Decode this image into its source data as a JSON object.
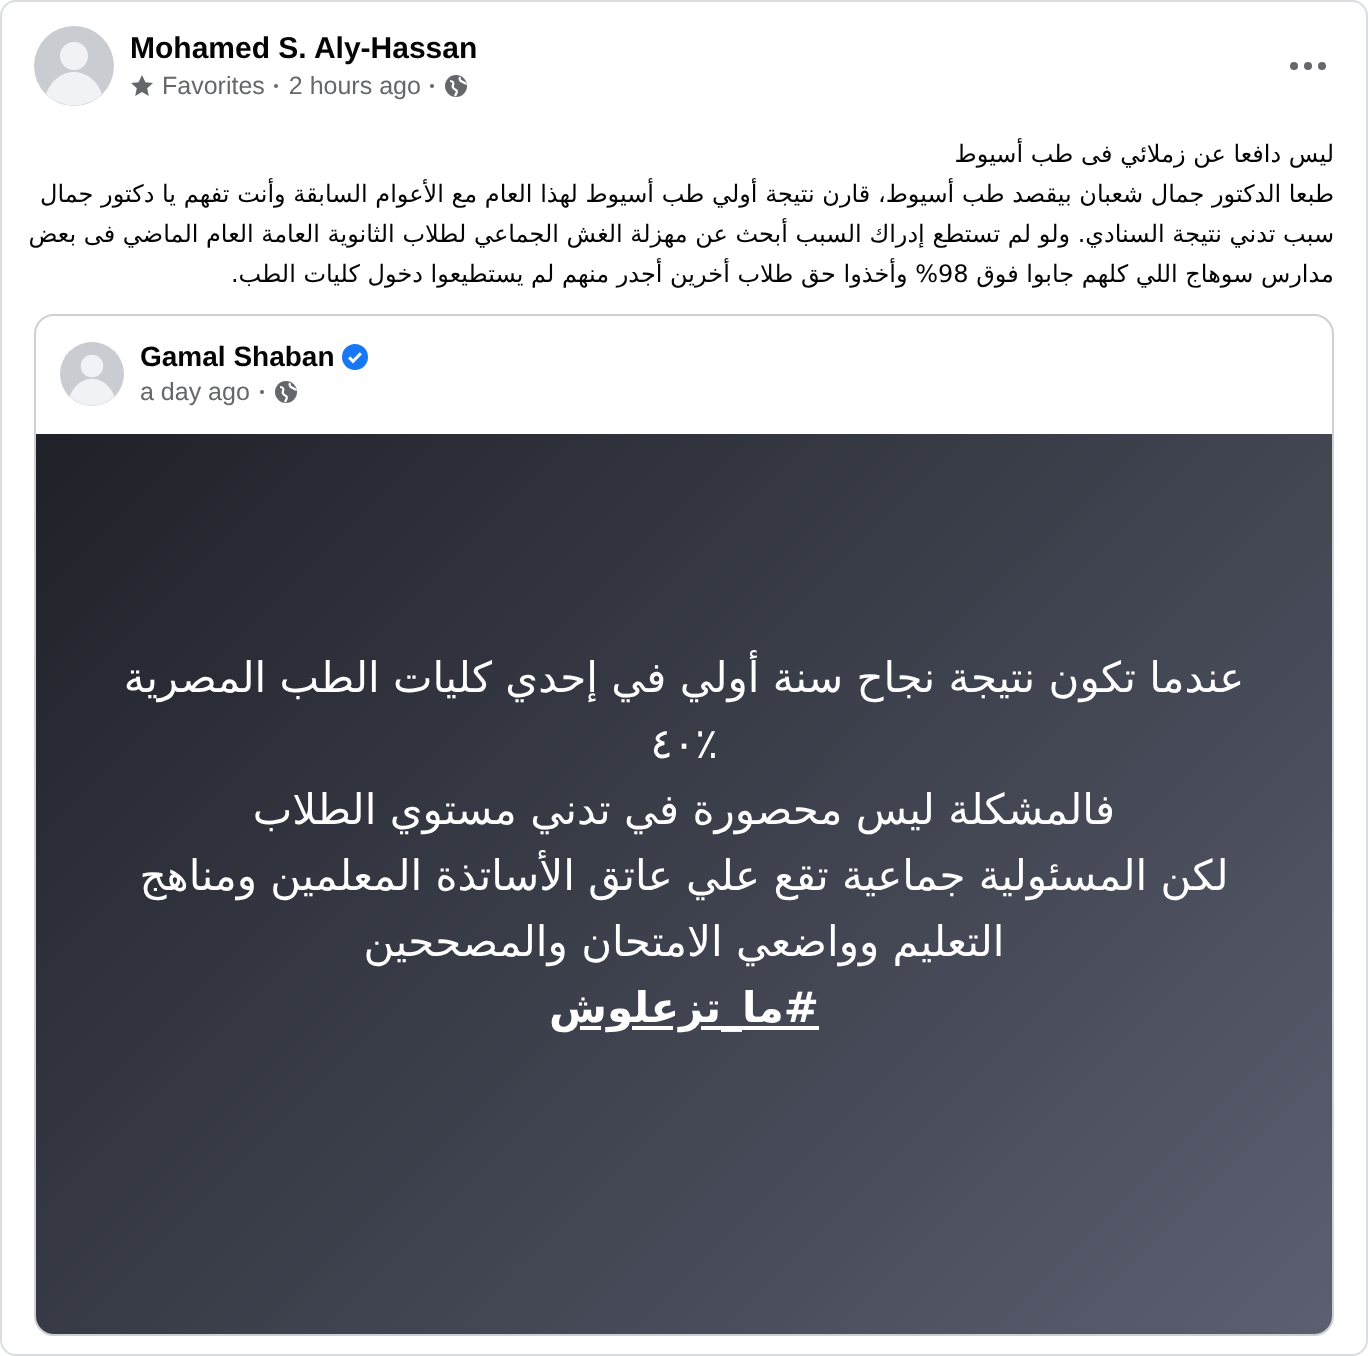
{
  "post": {
    "author": "Mohamed S. Aly-Hassan",
    "audience": "Favorites",
    "time": "2 hours ago",
    "text_lines": [
      "ليس دافعا عن زملائي فى طب أسيوط",
      "طبعا الدكتور جمال شعبان بيقصد طب أسيوط، قارن نتيجة أولي طب أسيوط لهذا العام مع الأعوام السابقة وأنت تفهم يا دكتور جمال",
      "سبب تدني نتيجة السنادي. ولو لم تستطع إدراك السبب أبحث عن مهزلة الغش الجماعي لطلاب الثانوية العامة العام الماضي فى بعض",
      "مدارس سوهاج اللي كلهم جابوا فوق 98% وأخذوا حق طلاب أخرين أجدر منهم لم يستطيعوا دخول كليات الطب."
    ]
  },
  "shared_post": {
    "author": "Gamal Shaban",
    "verified": true,
    "time": "a day ago",
    "text_lines": [
      "عندما تكون نتيجة نجاح سنة أولي في إحدي كليات الطب المصرية",
      "٪٤٠",
      "فالمشكلة ليس محصورة في تدني مستوي الطلاب",
      "لكن المسئولية جماعية تقع علي عاتق الأساتذة المعلمين ومناهج",
      "التعليم وواضعي الامتحان والمصححين"
    ],
    "hashtag": "#ما_تزعلوش"
  }
}
